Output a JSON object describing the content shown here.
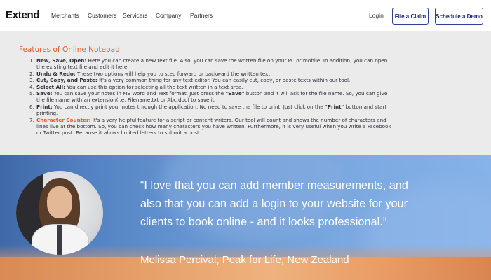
{
  "nav": {
    "logo": "Extend",
    "links": [
      "Merchants",
      "Customers",
      "Servicers",
      "Company",
      "Partners"
    ],
    "login": "Login",
    "file_claim": "File a Claim",
    "schedule_demo": "Schedule a Demo"
  },
  "features": {
    "title": "Features of Online Notepad",
    "items": [
      {
        "num": "1.",
        "title": "New, Save, Open:",
        "text": " Here you can create a new text file. Also, you can save the written file on your PC or mobile. In addition, you can open",
        "text2": "the existing text file and edit it here."
      },
      {
        "num": "2.",
        "title": "Undo & Redo:",
        "text": " These two options will help you to step forward or backward the written text."
      },
      {
        "num": "3.",
        "title": "Cut, Copy, and Paste:",
        "text": " It's a very common thing for any text editor. You can easily cut, copy, or paste texts within our tool."
      },
      {
        "num": "4.",
        "title": "Select All:",
        "text": " You can use this option for selecting all the text written in a text area."
      },
      {
        "num": "5.",
        "title": "Save:",
        "text": " You can save your notes in MS Word and Text format. Just press the ",
        "bold": "\"Save\"",
        "text_after": " button and it will ask for the file name. So, you can give",
        "text2": "the file name with an extension(i.e. Filename.txt or Abc.doc) to save it."
      },
      {
        "num": "6.",
        "title": "Print:",
        "text": " You can directly print your notes through the application. No need to save the file to print. Just click on the ",
        "bold": "\"Print\"",
        "text_after": " button and start",
        "text2": "printing."
      },
      {
        "num": "7.",
        "title": "Character Counter:",
        "text": " It's a very helpful feature for a script or content writers. Our tool will count and shows the number of characters and",
        "text2": "lines live at the bottom. So, you can check how many characters you have written. Furthermore, it is very useful when you write a Facebook",
        "text3": "or Twitter post. Because it allows limited letters to submit a post."
      }
    ]
  },
  "testimonial": {
    "quote_line1": "“I love that you can add member measurements, and",
    "quote_line2": "also that you can add a login to your website for your",
    "quote_line3": "clients to book online - and it looks professional.”",
    "author": "Melissa Percival, Peak for Life, New Zealand"
  }
}
